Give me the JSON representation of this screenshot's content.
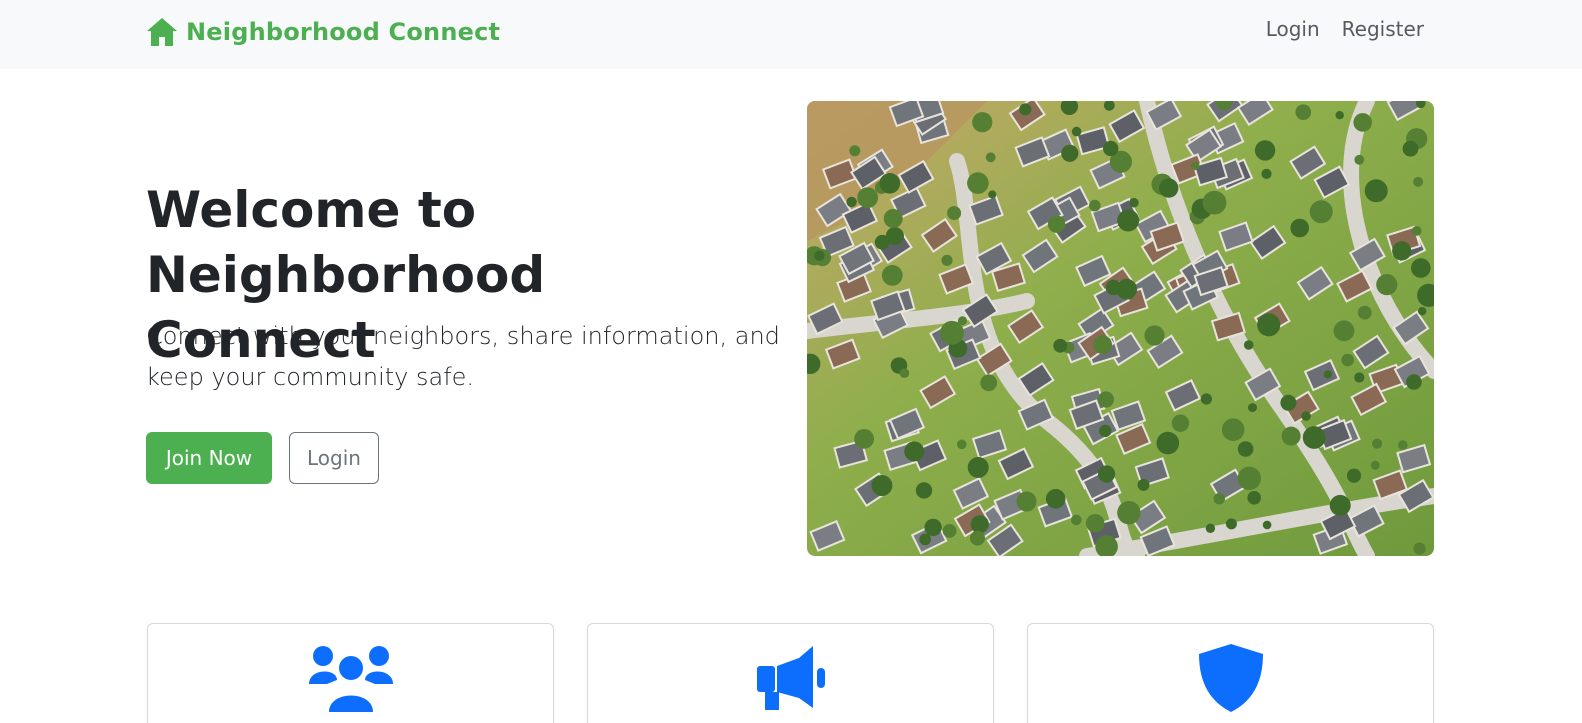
{
  "navbar": {
    "brand_name": "Neighborhood Connect",
    "brand_icon": "home-icon",
    "links": [
      "Login",
      "Register"
    ]
  },
  "hero": {
    "title": "Welcome to Neighborhood Connect",
    "lead": "Connect with your neighbors, share information, and keep your community safe.",
    "primary_button": "Join Now",
    "secondary_button": "Login",
    "image_subject": "aerial-view-of-suburban-neighborhood"
  },
  "features": [
    {
      "icon": "users-icon"
    },
    {
      "icon": "megaphone-icon"
    },
    {
      "icon": "shield-icon"
    }
  ],
  "colors": {
    "brand_green": "#4caf50",
    "feature_icon_blue": "#0d6efd",
    "navbar_bg": "#f8f9fa",
    "text_dark": "#212529",
    "outline_gray": "#6c757d"
  }
}
